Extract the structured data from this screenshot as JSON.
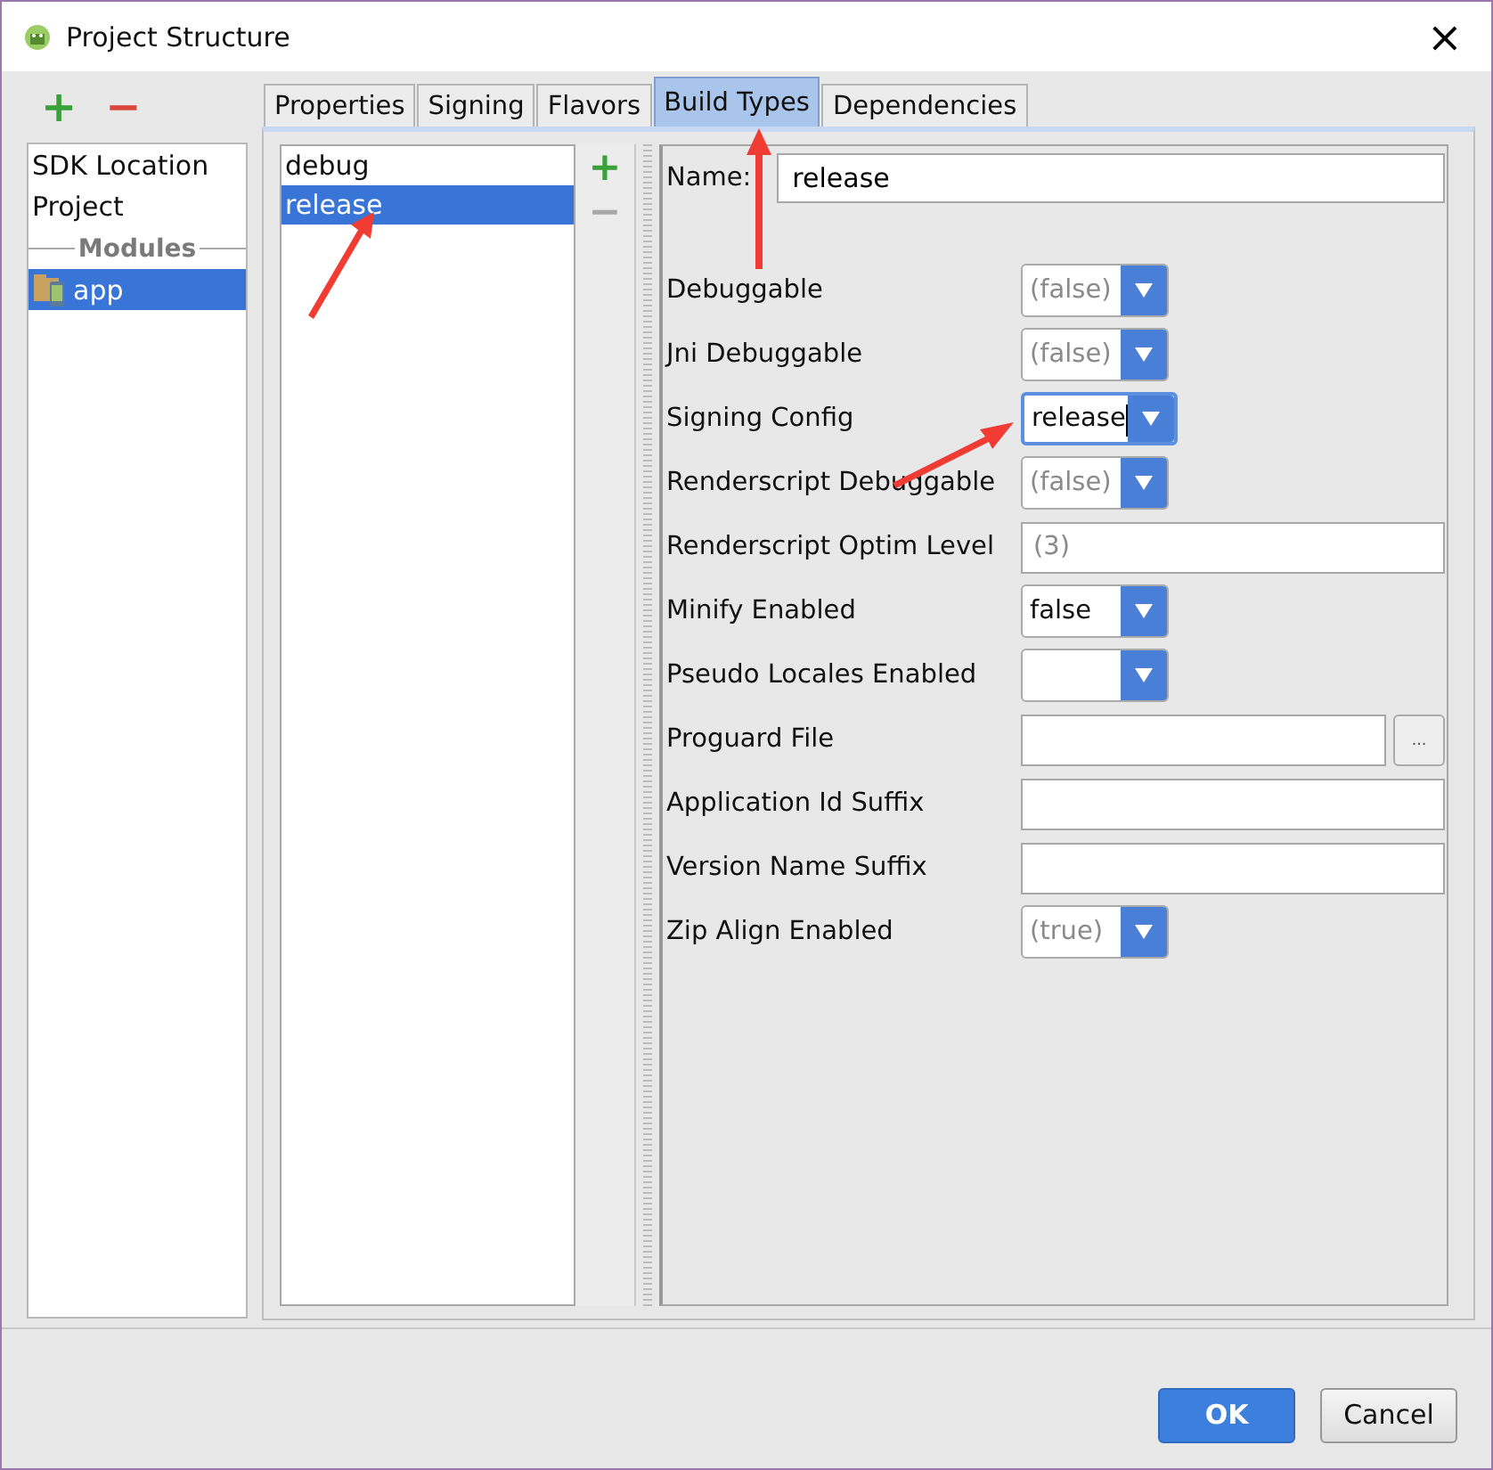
{
  "window": {
    "title": "Project Structure",
    "close": "×"
  },
  "sidebar": {
    "add": "+",
    "remove": "−",
    "items": [
      {
        "kind": "item",
        "label": "SDK Location",
        "selected": false
      },
      {
        "kind": "item",
        "label": "Project",
        "selected": false
      },
      {
        "kind": "header",
        "label": "Modules"
      },
      {
        "kind": "module",
        "label": "app",
        "selected": true
      }
    ]
  },
  "tabs": [
    {
      "label": "Properties",
      "selected": false
    },
    {
      "label": "Signing",
      "selected": false
    },
    {
      "label": "Flavors",
      "selected": false
    },
    {
      "label": "Build Types",
      "selected": true
    },
    {
      "label": "Dependencies",
      "selected": false
    }
  ],
  "build_types": {
    "add": "+",
    "remove": "−",
    "items": [
      {
        "label": "debug",
        "selected": false
      },
      {
        "label": "release",
        "selected": true
      }
    ]
  },
  "form": {
    "name": {
      "label": "Name:",
      "value": "release"
    },
    "rows": [
      {
        "kind": "combo",
        "label": "Debuggable",
        "placeholder": "(false)",
        "focused": false
      },
      {
        "kind": "combo",
        "label": "Jni Debuggable",
        "placeholder": "(false)",
        "focused": false
      },
      {
        "kind": "combo",
        "label": "Signing Config",
        "value": "release",
        "focused": true
      },
      {
        "kind": "combo",
        "label": "Renderscript Debuggable",
        "placeholder": "(false)",
        "focused": false
      },
      {
        "kind": "text",
        "label": "Renderscript Optim Level",
        "placeholder": "(3)"
      },
      {
        "kind": "combo",
        "label": "Minify Enabled",
        "value": "false",
        "focused": false
      },
      {
        "kind": "combo",
        "label": "Pseudo Locales Enabled",
        "focused": false
      },
      {
        "kind": "file",
        "label": "Proguard File",
        "browse": "..."
      },
      {
        "kind": "text",
        "label": "Application Id Suffix"
      },
      {
        "kind": "text",
        "label": "Version Name Suffix"
      },
      {
        "kind": "combo",
        "label": "Zip Align Enabled",
        "placeholder": "(true)",
        "focused": false
      }
    ]
  },
  "buttons": [
    {
      "label": "OK",
      "primary": true
    },
    {
      "label": "Cancel",
      "primary": false
    }
  ]
}
